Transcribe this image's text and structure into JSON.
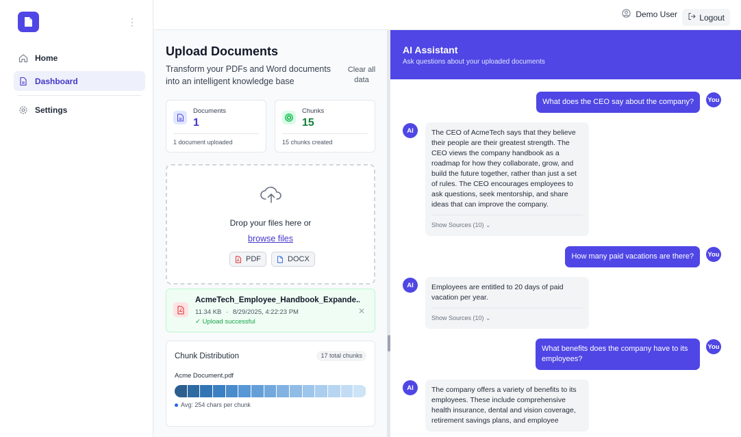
{
  "sidebar": {
    "items": [
      {
        "label": "Home",
        "icon": "home-icon"
      },
      {
        "label": "Dashboard",
        "icon": "document-icon"
      },
      {
        "label": "Settings",
        "icon": "gear-icon"
      }
    ]
  },
  "topbar": {
    "user_name": "Demo User",
    "logout_label": "Logout"
  },
  "upload": {
    "title": "Upload Documents",
    "subtitle": "Transform your PDFs and Word documents into an intelligent knowledge base",
    "clear_label": "Clear all data",
    "stats": {
      "documents": {
        "label": "Documents",
        "value": "1",
        "footer": "1 document uploaded"
      },
      "chunks": {
        "label": "Chunks",
        "value": "15",
        "footer": "15 chunks created"
      }
    },
    "dropzone": {
      "text": "Drop your files here or",
      "browse_label": "browse files",
      "formats": [
        "PDF",
        "DOCX"
      ]
    },
    "file": {
      "name": "AcmeTech_Employee_Handbook_Expande...",
      "size": "11.34 KB",
      "separator": "·",
      "date": "8/29/2025, 4:22:23 PM",
      "status": "✓ Upload successful"
    },
    "distribution": {
      "title": "Chunk Distribution",
      "badge": "17 total chunks",
      "document": "Acme Document.pdf",
      "avg": "Avg: 254 chars per chunk"
    }
  },
  "colors": {
    "accent": "#4f46e5",
    "success": "#16a34a",
    "chunk_scale": [
      "#2c5f8f",
      "#2f6ba3",
      "#3275b4",
      "#3a80c2",
      "#4a8bcc",
      "#5797d5",
      "#659fd8",
      "#73a8dd",
      "#82b2e2",
      "#90bce6",
      "#9ec5ea",
      "#abcdee",
      "#b7d5f1",
      "#c2dcf3",
      "#cde3f6"
    ]
  },
  "chat": {
    "title": "AI Assistant",
    "subtitle": "Ask questions about your uploaded documents",
    "user_avatar": "You",
    "ai_avatar": "AI",
    "messages": [
      {
        "role": "user",
        "text": "What does the CEO say about the company?"
      },
      {
        "role": "ai",
        "text": "The CEO of AcmeTech says that they believe their people are their greatest strength. The CEO views the company handbook as a roadmap for how they collaborate, grow, and build the future together, rather than just a set of rules. The CEO encourages employees to ask questions, seek mentorship, and share ideas that can improve the company.",
        "sources": "Show Sources (10) ⌄"
      },
      {
        "role": "user",
        "text": "How many paid vacations are there?"
      },
      {
        "role": "ai",
        "text": "Employees are entitled to 20 days of paid vacation per year.",
        "sources": "Show Sources (10) ⌄"
      },
      {
        "role": "user",
        "text": "What benefits does the company have to its employees?"
      },
      {
        "role": "ai",
        "text": "The company offers a variety of benefits to its employees. These include comprehensive health insurance, dental and vision coverage, retirement savings plans, and employee"
      }
    ]
  }
}
